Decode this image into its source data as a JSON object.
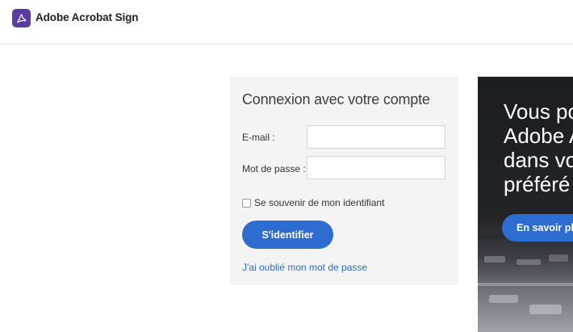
{
  "header": {
    "brand": "Adobe Acrobat Sign",
    "logo_icon": "adobe-acrobat-icon",
    "logo_color": "#5a3ca4"
  },
  "login": {
    "title": "Connexion avec votre compte",
    "email_label": "E-mail :",
    "email_value": "",
    "password_label": "Mot de passe :",
    "password_value": "",
    "remember_label": "Se souvenir de mon identifiant",
    "remember_checked": false,
    "signin_label": "S'identifier",
    "forgot_label": "J'ai oublié mon mot de passe"
  },
  "promo": {
    "line1": "Vous po",
    "line2": "Adobe A",
    "line3": "dans vo",
    "line4": "préféré",
    "button_label": "En savoir pl"
  },
  "colors": {
    "accent": "#2f6cd0",
    "panel_bg": "#f4f4f4"
  }
}
